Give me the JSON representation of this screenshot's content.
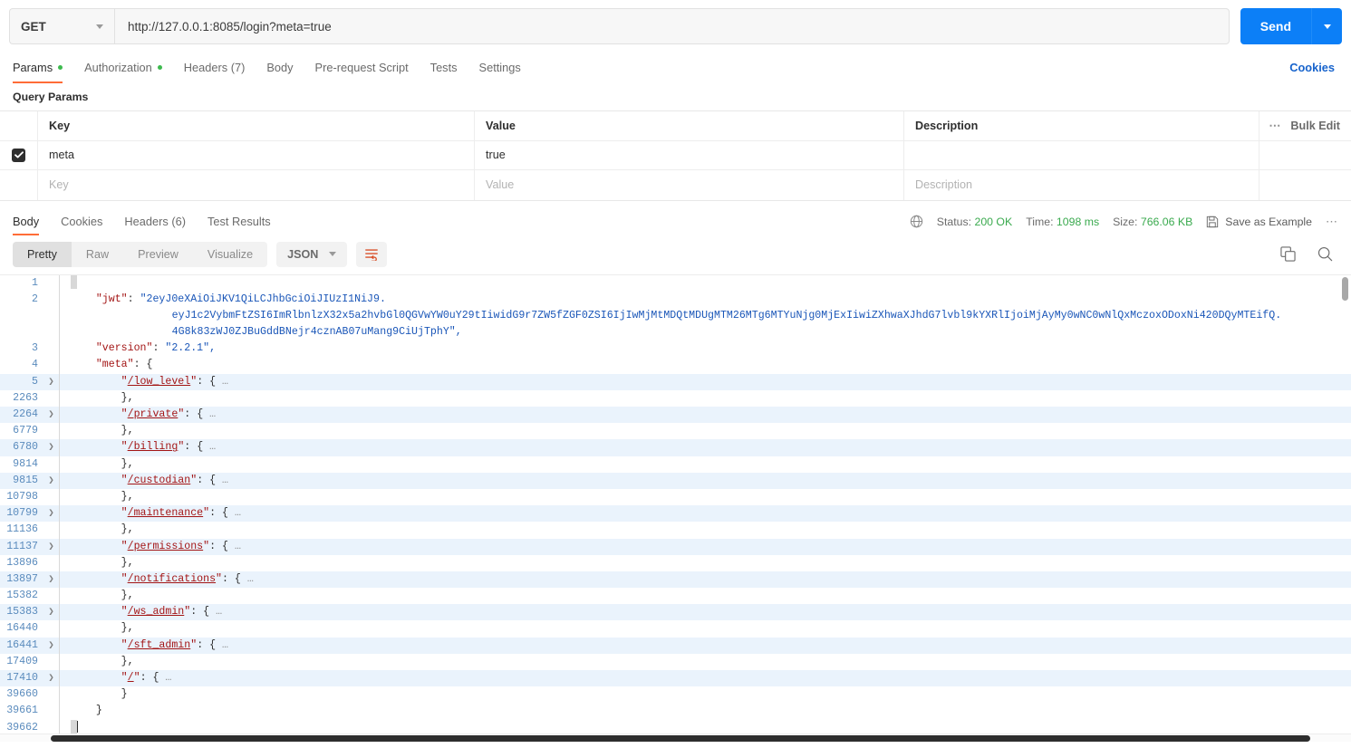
{
  "request": {
    "method": "GET",
    "url": "http://127.0.0.1:8085/login?meta=true",
    "send_label": "Send",
    "tabs": [
      {
        "label": "Params",
        "dot": true,
        "active": true
      },
      {
        "label": "Authorization",
        "dot": true,
        "active": false
      },
      {
        "label": "Headers (7)",
        "dot": false,
        "active": false
      },
      {
        "label": "Body",
        "dot": false,
        "active": false
      },
      {
        "label": "Pre-request Script",
        "dot": false,
        "active": false
      },
      {
        "label": "Tests",
        "dot": false,
        "active": false
      },
      {
        "label": "Settings",
        "dot": false,
        "active": false
      }
    ],
    "cookies_link": "Cookies"
  },
  "query_params": {
    "section_title": "Query Params",
    "headers": {
      "key": "Key",
      "value": "Value",
      "description": "Description"
    },
    "bulk_edit": "Bulk Edit",
    "rows": [
      {
        "checked": true,
        "key": "meta",
        "value": "true",
        "description": ""
      }
    ],
    "placeholder_row": {
      "key": "Key",
      "value": "Value",
      "description": "Description"
    }
  },
  "response": {
    "tabs": [
      {
        "label": "Body",
        "active": true
      },
      {
        "label": "Cookies",
        "active": false
      },
      {
        "label": "Headers (6)",
        "active": false
      },
      {
        "label": "Test Results",
        "active": false
      }
    ],
    "status_label": "Status:",
    "status_value": "200 OK",
    "time_label": "Time:",
    "time_value": "1098 ms",
    "size_label": "Size:",
    "size_value": "766.06 KB",
    "save_example": "Save as Example",
    "view_modes": [
      {
        "label": "Pretty",
        "active": true
      },
      {
        "label": "Raw",
        "active": false
      },
      {
        "label": "Preview",
        "active": false
      },
      {
        "label": "Visualize",
        "active": false
      }
    ],
    "format": "JSON"
  },
  "body": {
    "jwt_key": "\"jwt\"",
    "jwt_seg1": "\"2eyJ0eXAiOiJKV1QiLCJhbGciOiJIUzI1NiJ9.",
    "jwt_seg2": "eyJ1c2VybmFtZSI6ImRlbnlzX32x5a2hvbGl0QGVwYW0uY29tIiwidG9r7ZW5fZGF0ZSI6IjIwMjMtMDQtMDUgMTM26MTg6MTYuNjg0MjExIiwiZXhwaXJhdG7lvbl9kYXRlIjoiMjAyMy0wNC0wNlQxMczoxODoxNi420DQyMTEifQ.",
    "jwt_seg3": "4G8k83zWJ0ZJBuGddBNejr4cznAB07uMang9CiUjTphY\",",
    "version_key": "\"version\"",
    "version_val": "\"2.2.1\",",
    "meta_key": "\"meta\"",
    "entries": [
      {
        "open_line": "5",
        "close_line": "2263",
        "key": "/low_level",
        "trailing_comma": true
      },
      {
        "open_line": "2264",
        "close_line": "6779",
        "key": "/private",
        "trailing_comma": true
      },
      {
        "open_line": "6780",
        "close_line": "9814",
        "key": "/billing",
        "trailing_comma": true
      },
      {
        "open_line": "9815",
        "close_line": "10798",
        "key": "/custodian",
        "trailing_comma": true
      },
      {
        "open_line": "10799",
        "close_line": "11136",
        "key": "/maintenance",
        "trailing_comma": true
      },
      {
        "open_line": "11137",
        "close_line": "13896",
        "key": "/permissions",
        "trailing_comma": true
      },
      {
        "open_line": "13897",
        "close_line": "15382",
        "key": "/notifications",
        "trailing_comma": true
      },
      {
        "open_line": "15383",
        "close_line": "16440",
        "key": "/ws_admin",
        "trailing_comma": true
      },
      {
        "open_line": "16441",
        "close_line": "17409",
        "key": "/sft_admin",
        "trailing_comma": true
      },
      {
        "open_line": "17410",
        "close_line": "39660",
        "key": "/",
        "trailing_comma": false
      }
    ],
    "line_1": "1",
    "line_2": "2",
    "line_3": "3",
    "line_4": "4",
    "close_meta_line": "39661",
    "close_root_line": "39662",
    "ellipsis": "…"
  },
  "colors": {
    "accent": "#ff6c37",
    "send_blue": "#0c7ff7",
    "link_blue": "#1763cc",
    "status_green": "#3aaa4e",
    "json_key_red": "#a31515",
    "json_string_blue": "#1a56b8",
    "gutter_blue": "#5a8bbd",
    "row_highlight": "#eaf3fc"
  }
}
